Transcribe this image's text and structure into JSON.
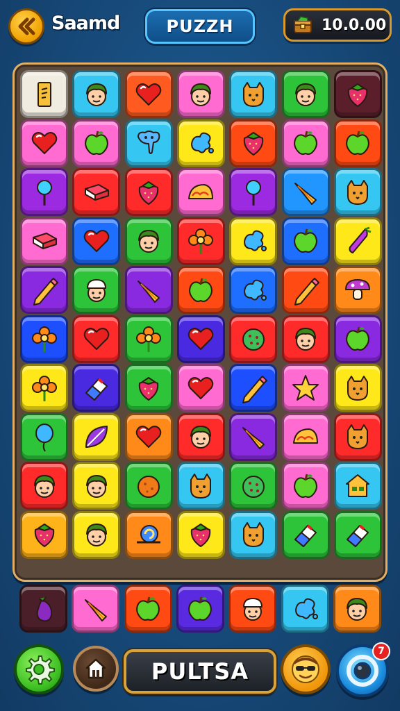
{
  "header": {
    "back_icon": "double-chevron-left-icon",
    "player_name": "Saamd",
    "title": "PUZZH",
    "score": "10.0.00",
    "score_icon": "treasure-box-icon"
  },
  "board": {
    "columns": 7,
    "rows": 10,
    "tiles": [
      {
        "color": "#f1ece0",
        "icon": "note-card-icon"
      },
      {
        "color": "#35c7f2",
        "icon": "boy-face-icon"
      },
      {
        "color": "#ff5a1f",
        "icon": "heart-icon"
      },
      {
        "color": "#ff6bd0",
        "icon": "boy-face-icon"
      },
      {
        "color": "#35c7f2",
        "icon": "cat-face-icon"
      },
      {
        "color": "#2dc43a",
        "icon": "boy-face-icon"
      },
      {
        "color": "#5a1f2a",
        "icon": "strawberry-icon"
      },
      {
        "color": "#ff6bd0",
        "icon": "heart-icon"
      },
      {
        "color": "#ff6bd0",
        "icon": "apple-icon"
      },
      {
        "color": "#35c7f2",
        "icon": "elephant-icon"
      },
      {
        "color": "#ffe81a",
        "icon": "splash-icon"
      },
      {
        "color": "#ff4a14",
        "icon": "strawberry-icon"
      },
      {
        "color": "#ff6bd0",
        "icon": "apple-icon"
      },
      {
        "color": "#ff4a14",
        "icon": "apple-icon"
      },
      {
        "color": "#9b2ae0",
        "icon": "lollipop-icon"
      },
      {
        "color": "#ff2a2a",
        "icon": "book-icon"
      },
      {
        "color": "#ff2a2a",
        "icon": "strawberry-icon"
      },
      {
        "color": "#ff6bd0",
        "icon": "taco-icon"
      },
      {
        "color": "#9b2ae0",
        "icon": "lollipop-icon"
      },
      {
        "color": "#2196ff",
        "icon": "party-horn-icon"
      },
      {
        "color": "#35c7f2",
        "icon": "cat-face-icon"
      },
      {
        "color": "#ff6bd0",
        "icon": "book-icon"
      },
      {
        "color": "#1e6eff",
        "icon": "heart-icon"
      },
      {
        "color": "#2dc43a",
        "icon": "boy-face-icon"
      },
      {
        "color": "#ff2a2a",
        "icon": "flower-icon"
      },
      {
        "color": "#ffe81a",
        "icon": "splash-icon"
      },
      {
        "color": "#1e6eff",
        "icon": "apple-icon"
      },
      {
        "color": "#ffe81a",
        "icon": "carrot-icon"
      },
      {
        "color": "#8a2ae0",
        "icon": "pencil-icon"
      },
      {
        "color": "#2dc43a",
        "icon": "chef-face-icon"
      },
      {
        "color": "#8a2ae0",
        "icon": "party-horn-icon"
      },
      {
        "color": "#ff4a14",
        "icon": "apple-icon"
      },
      {
        "color": "#1e6eff",
        "icon": "splash-icon"
      },
      {
        "color": "#ff4a14",
        "icon": "pencil-icon"
      },
      {
        "color": "#ff8a1a",
        "icon": "mushroom-icon"
      },
      {
        "color": "#1e4fff",
        "icon": "flower-icon"
      },
      {
        "color": "#ff2a2a",
        "icon": "heart-icon"
      },
      {
        "color": "#2dc43a",
        "icon": "flower-icon"
      },
      {
        "color": "#4a2ae0",
        "icon": "heart-icon"
      },
      {
        "color": "#ff2a2a",
        "icon": "melon-icon"
      },
      {
        "color": "#ff2a2a",
        "icon": "boy-face-icon"
      },
      {
        "color": "#8a2ae0",
        "icon": "apple-icon"
      },
      {
        "color": "#ffe81a",
        "icon": "flower-icon"
      },
      {
        "color": "#4a2ae0",
        "icon": "eraser-icon"
      },
      {
        "color": "#2dc43a",
        "icon": "strawberry-icon"
      },
      {
        "color": "#ff6bd0",
        "icon": "heart-icon"
      },
      {
        "color": "#1e4fff",
        "icon": "pencil-icon"
      },
      {
        "color": "#ff6bd0",
        "icon": "star-icon"
      },
      {
        "color": "#ffe81a",
        "icon": "cat-face-icon"
      },
      {
        "color": "#2dc43a",
        "icon": "balloon-icon"
      },
      {
        "color": "#ffe81a",
        "icon": "leaf-icon"
      },
      {
        "color": "#ff8a1a",
        "icon": "heart-icon"
      },
      {
        "color": "#ff2a2a",
        "icon": "boy-face-icon"
      },
      {
        "color": "#8a2ae0",
        "icon": "party-horn-icon"
      },
      {
        "color": "#ff6bd0",
        "icon": "taco-icon"
      },
      {
        "color": "#ff2a2a",
        "icon": "cat-face-icon"
      },
      {
        "color": "#ff2a2a",
        "icon": "boy-face-icon"
      },
      {
        "color": "#ffe81a",
        "icon": "boy-face-icon"
      },
      {
        "color": "#2dc43a",
        "icon": "orange-icon"
      },
      {
        "color": "#35c7f2",
        "icon": "cat-face-icon"
      },
      {
        "color": "#2dc43a",
        "icon": "melon-icon"
      },
      {
        "color": "#ff6bd0",
        "icon": "apple-icon"
      },
      {
        "color": "#35c7f2",
        "icon": "house-icon"
      },
      {
        "color": "#ffb31a",
        "icon": "strawberry-icon"
      },
      {
        "color": "#ffe81a",
        "icon": "boy-face-icon"
      },
      {
        "color": "#ff8a1a",
        "icon": "snail-icon"
      },
      {
        "color": "#ffe81a",
        "icon": "strawberry-icon"
      },
      {
        "color": "#35c7f2",
        "icon": "cat-face-icon"
      },
      {
        "color": "#2dc43a",
        "icon": "eraser-icon"
      },
      {
        "color": "#2dc43a",
        "icon": "eraser-icon"
      }
    ]
  },
  "tray": {
    "tiles": [
      {
        "color": "#4a1f2a",
        "icon": "eggplant-icon"
      },
      {
        "color": "#ff6bd0",
        "icon": "party-horn-icon"
      },
      {
        "color": "#ff4a14",
        "icon": "apple-icon"
      },
      {
        "color": "#5a2ae0",
        "icon": "apple-icon"
      },
      {
        "color": "#ff4a14",
        "icon": "chef-face-icon"
      },
      {
        "color": "#35c7f2",
        "icon": "splash-icon"
      },
      {
        "color": "#ff8a1a",
        "icon": "boy-face-icon"
      }
    ]
  },
  "footer": {
    "settings_icon": "gear-icon",
    "home_icon": "home-icon",
    "action_label": "PULTSA",
    "avatar_icon": "face-sunglasses-icon",
    "target_icon": "target-ring-icon",
    "notification_count": "7"
  }
}
